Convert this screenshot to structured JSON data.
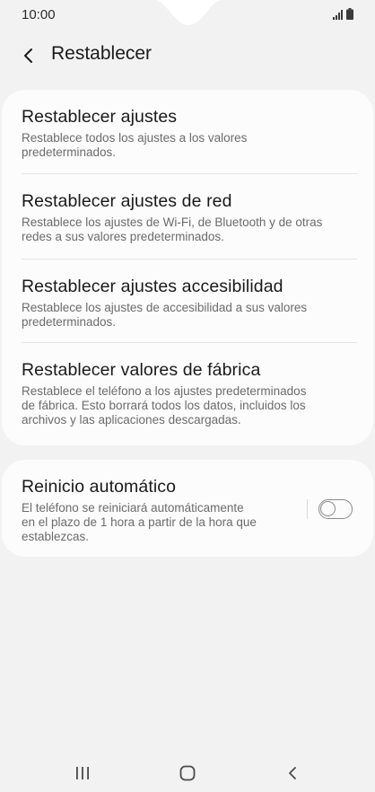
{
  "status_bar": {
    "time": "10:00",
    "icons": [
      "signal-icon",
      "battery-icon"
    ]
  },
  "header": {
    "title": "Restablecer",
    "back_icon": "chevron-left-icon"
  },
  "reset_options": [
    {
      "title": "Restablecer ajustes",
      "description_lines": [
        "Restablece todos los ajustes a los valores",
        "predeterminados."
      ]
    },
    {
      "title": "Restablecer ajustes de red",
      "description_lines": [
        "Restablece los ajustes de Wi-Fi, de Bluetooth y de otras",
        "redes a sus valores predeterminados."
      ]
    },
    {
      "title": "Restablecer ajustes accesibilidad",
      "description_lines": [
        "Restablece los ajustes de accesibilidad a sus valores",
        "predeterminados."
      ]
    },
    {
      "title": "Restablecer valores de fábrica",
      "description_lines": [
        "Restablece el teléfono a los ajustes predeterminados",
        "de fábrica. Esto borrará todos los datos, incluidos los",
        "archivos y las aplicaciones descargadas."
      ]
    }
  ],
  "auto_restart": {
    "title": "Reinicio automático",
    "description_lines": [
      "El teléfono se reiniciará automáticamente",
      "en el plazo de 1 hora a partir de la hora que",
      "establezcas."
    ],
    "toggle_on": false
  },
  "nav_bar": {
    "icons": [
      "recent-apps-icon",
      "home-icon",
      "back-icon"
    ]
  },
  "colors": {
    "background": "#f2f2f2",
    "card": "#fcfcfc",
    "title_text": "#1a1a1a",
    "description_text": "#6b6b6b",
    "divider": "#e4e4e4"
  }
}
